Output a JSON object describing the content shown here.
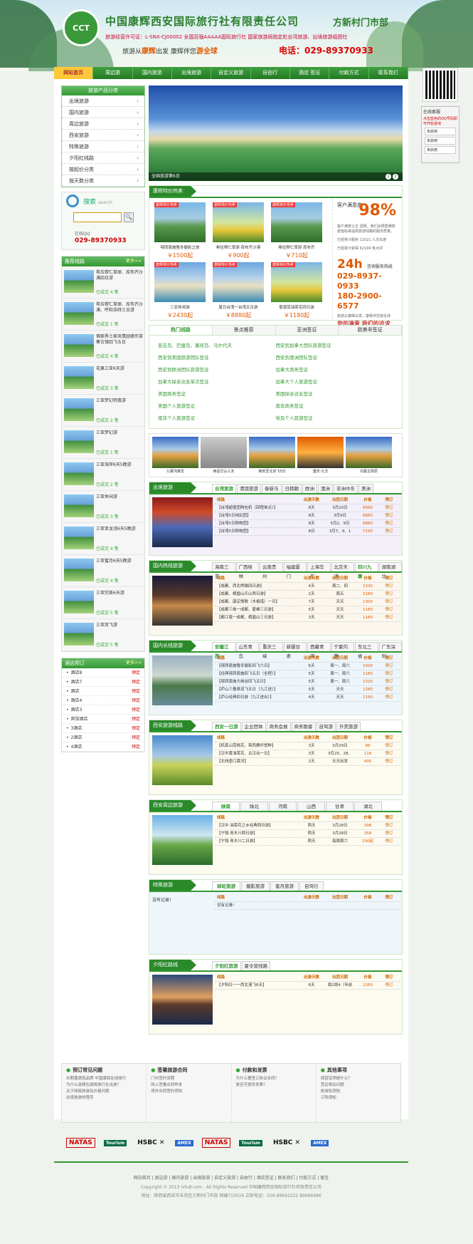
{
  "header": {
    "logo_text": "CCT",
    "company": "中国康辉西安国际旅行社有限责任公司",
    "branch": "方新村门市部",
    "license": "旅游经营许可证：L-SNX-CJ00002   全国百强AAAAA国际旅行社   国家旅游局指定赴台湾旅游、出境旅游组团社",
    "slogan_a": "旅游从",
    "slogan_b": "康辉",
    "slogan_c": "出发   康辉伴您",
    "slogan_d": "游全球",
    "phone": "电话：029-89370933"
  },
  "nav": [
    "网站首页",
    "周边游",
    "国内旅游",
    "出境旅游",
    "自定义旅游",
    "自由行",
    "酒店 签证",
    "付款方式",
    "联系我们"
  ],
  "kefu": {
    "title": "在线客服",
    "sub": "点击蓝色的QQ号码即可开始咨询",
    "btns": [
      "未启用",
      "未启用",
      "未启用"
    ]
  },
  "sidebar": {
    "cat_title": "旅游产品分类",
    "cats": [
      "出境旅游",
      "国内旅游",
      "周边旅游",
      "西安旅游",
      "特殊旅游",
      "夕阳红线路",
      "按起价分类",
      "按天数分类"
    ],
    "search_title": "搜索",
    "search_sub": "search",
    "search_btn": "🔍",
    "qq_label": "在线QQ",
    "tel": "029-89370933",
    "rec_title": "推荐线路",
    "more": "更多>>",
    "rec": [
      {
        "title": "希拉穆仁草原、库布齐沙漠四日游",
        "sold": "已成交 4 笔"
      },
      {
        "title": "希拉穆仁草原、库布齐沙漠、呼和浩特三日游",
        "sold": "已成交 1 笔"
      },
      {
        "title": "佛家界土家风情园德夯苗寨古镇四飞五日",
        "sold": "已成交 4 笔"
      },
      {
        "title": "花果三亚6天游",
        "sold": "已成交 3 笔"
      },
      {
        "title": "三亚梦幻特惠游",
        "sold": "已成交 2 笔"
      },
      {
        "title": "三亚梦幻游",
        "sold": "已成交 1 笔"
      },
      {
        "title": "三亚海岸6天5晚游",
        "sold": "已成交 2 笔"
      },
      {
        "title": "三亚休闲游",
        "sold": "已成交 3 笔"
      },
      {
        "title": "三亚亚龙湾6天5晚游",
        "sold": "已成交 4 笔"
      },
      {
        "title": "三亚蜜月6天5晚游",
        "sold": "已成交 4 笔"
      },
      {
        "title": "三亚完美6天游",
        "sold": "已成交 5 笔"
      },
      {
        "title": "三亚双飞游",
        "sold": "已成交 5 笔"
      }
    ],
    "hotel_title": "酒店预订",
    "hotels": [
      "酒店8",
      "酒店7",
      "酒店",
      "酒店4",
      "酒店3",
      "宾馆酒店",
      "3酒店",
      "2酒店",
      "4酒店"
    ],
    "book": "预定"
  },
  "banner": {
    "caption": "全国旅游第6日"
  },
  "special": {
    "title": "康辉特价热卖",
    "tag": "康辉特价热卖",
    "cards": [
      {
        "name": "鄂西恩施隆冬摄影之旅",
        "price": "￥1500起"
      },
      {
        "name": "希拉穆仁草原·库布齐沙漠",
        "price": "￥900起"
      },
      {
        "name": "希拉穆仁草原·库布齐",
        "price": "￥710起"
      },
      {
        "name": "三亚休闲游",
        "price": "￥2430起"
      },
      {
        "name": "夏日台湾一台湾五日游",
        "price": "￥8880起"
      },
      {
        "name": "婺源赏油菜花四日游",
        "price": "￥1180起"
      }
    ],
    "sat_label": "客户满意度",
    "sat_pct": "98%",
    "sat_text": "客户满意公正·透明，我们会根据满意度指标来提高旅游线路的服务质量。",
    "stat1": "已经累计服务 11021 人次出游",
    "stat2": "已经累计获得 62194 条点评",
    "h24": "24h",
    "h24_sub": "咨询服务热线",
    "tel1": "029-8937-0933",
    "tel2": "180-2900-6577",
    "foot": "旅游从康辉出发，康辉伴您游全球",
    "foot2": "您的满意  我们的追求"
  },
  "hotlinks": {
    "tabs": [
      "热门线路",
      "景点推荐",
      "亚洲签证",
      "欧美非签证"
    ],
    "items": [
      "普吉岛、巴厘岛、塞班岛、马尔代夫",
      "西安到加拿大团队旅游签证",
      "西安到美国旅游团队签证",
      "西安到澳洲团队签证",
      "西安到欧洲团队旅游签证",
      "加拿大商务签证",
      "加拿大探亲访友单次签证",
      "加拿大个人旅游签证",
      "美国商务签证",
      "美国探亲访友签证",
      "美国个人旅游签证",
      "南非商务签证",
      "南非个人旅游签证",
      "埃及个人旅游签证"
    ]
  },
  "strip": [
    "九寨沟黄龙",
    "西岳华山三天",
    "西安至北京飞5日",
    "重庆·九华",
    "内蒙古草原"
  ],
  "outbound": {
    "title": "出境旅游",
    "tabs": [
      "台湾旅游",
      "港澳旅游",
      "泰新马",
      "日韩朝",
      "欧洲",
      "澳洲",
      "非洲中东",
      "美洲"
    ],
    "head": [
      "线路",
      "出游天数",
      "出团日期",
      "价格",
      "预订"
    ],
    "rows": [
      [
        "【台湾超值团购包机（回程单点）】",
        "8天",
        "3月10日",
        "6990",
        "预订"
      ],
      [
        "【台湾5日纯玩团】",
        "8天",
        "3月9日",
        "6880",
        "预订"
      ],
      [
        "【台湾5日购物团】",
        "8天",
        "5月2、9日",
        "6880",
        "预订"
      ],
      [
        "【台湾5日购物团】",
        "8日",
        "3月7、9、1",
        "7190",
        "预订"
      ]
    ]
  },
  "domestic_hot": {
    "title": "国内热线旅游",
    "tabs": [
      "海南三亚",
      "广西桂林",
      "云南贵州",
      "福建厦门",
      "上海华东",
      "北京天津",
      "四川九寨",
      "湖南湖北"
    ],
    "head": [
      "线路",
      "出游天数",
      "出团日期",
      "价格",
      "预订"
    ],
    "rows": [
      [
        "【成都、西北熊猫四日游】",
        "4天",
        "周二、四",
        "1330",
        "预订"
      ],
      [
        "【成都、峨眉山乐山两日游】",
        "2天",
        "周五",
        "2180",
        "预订"
      ],
      [
        "【成都、康定情歌（木格措）一日】",
        "7天",
        "天天",
        "1300",
        "预订"
      ],
      [
        "【成都三峡一成都、夏峰三日游】",
        "5天",
        "天天",
        "1180",
        "预订"
      ],
      [
        "【都江堰一成都、峨眉山三日游】",
        "3天",
        "天天",
        "1180",
        "预订"
      ]
    ]
  },
  "domestic_long": {
    "title": "国内长线旅游",
    "tabs": [
      "安徽江西",
      "山东青岛",
      "重庆三峡",
      "新疆甘肃",
      "西藏青海",
      "宁夏内蒙",
      "东北三省",
      "广东深圳"
    ],
    "head": [
      "线路",
      "出游天数",
      "出团日期",
      "价格",
      "预订"
    ],
    "rows": [
      [
        "【鄂西恩施隆冬摄影四飞六日】",
        "6天",
        "周一、周六",
        "1500",
        "预订"
      ],
      [
        "【经典鄂西恩施四飞五日（全程）】",
        "5天",
        "周一、周六",
        "1180",
        "预订"
      ],
      [
        "【鄂西恩施大峡谷四飞五日】",
        "5天",
        "周一、周六",
        "1320",
        "预订"
      ],
      [
        "【庐山三叠泉双飞五日（九江进）】",
        "5天",
        "天天",
        "1280",
        "预订"
      ],
      [
        "【庐山经典四日游（九江进出）】",
        "4天",
        "天天",
        "1190",
        "预订"
      ]
    ]
  },
  "xian": {
    "title": "西安旅游线路",
    "tabs": [
      "西安一日游",
      "企业团体",
      "商务会展",
      "商务散客",
      "自驾游",
      "外宾旅游"
    ],
    "head": [
      "线路",
      "出游天数",
      "出团日期",
      "价格",
      "预订"
    ],
    "rows": [
      [
        "【机蒸山赏桃花，蒋西赛纤馆鲜】",
        "3天",
        "3月29日",
        "96",
        "预订"
      ],
      [
        "【汉中黄油菜花、古汉台一日】",
        "3天",
        "3月25、28、",
        "118",
        "预订"
      ],
      [
        "【北线壶口黄河】",
        "2天",
        "天天出发",
        "400",
        "预订"
      ]
    ]
  },
  "around": {
    "title": "西安周边旅游",
    "tabs": [
      "陕南",
      "陕北",
      "河南",
      "山西",
      "甘肃",
      "湖北"
    ],
    "head": [
      "线路",
      "出游天数",
      "出团日期",
      "价格",
      "预订"
    ],
    "rows": [
      [
        "【汉中·油菜花之乡经典两日游】",
        "两天",
        "3月28日",
        "398",
        "预订"
      ],
      [
        "【宁强·青木川两日游】",
        "两天",
        "3月28日",
        "358",
        "预订"
      ],
      [
        "【宁强·青木川二日游】",
        "两天",
        "每周周六",
        "290起",
        "预订"
      ]
    ]
  },
  "special_travel": {
    "title": "特殊旅游",
    "tabs": [
      "邮轮旅游",
      "摄影旅游",
      "蜜月旅游",
      "自驾行"
    ],
    "empty": "没有记录!",
    "head": [
      "线路",
      "出游天数",
      "出团日期",
      "价格",
      "预订"
    ],
    "empty2": "没有记录!"
  },
  "sunset": {
    "title": "夕阳红路线",
    "tabs": [
      "夕阳红旅游",
      "夏令营线路"
    ],
    "head": [
      "线路",
      "出游天数",
      "出团日期",
      "价格",
      "预订"
    ],
    "rows": [
      [
        "【夕阳红一一西北漫飞6天】",
        "6天",
        "周2周4（年前",
        "2260",
        "预订"
      ]
    ]
  },
  "footer_cols": [
    {
      "title": "预订常见问题",
      "items": [
        "长期遭遇低品牌 中国康辉在线旅行",
        "为什么选择在康辉旅行社出游？",
        "关于网络旅游及价格问题",
        "出境旅游的程序"
      ]
    },
    {
      "title": "签署旅游合同",
      "items": [
        "门市签约流程",
        "网上签署合同样本",
        "境外合同签约须知"
      ]
    },
    {
      "title": "付款和发票",
      "items": [
        "为什么要签订协议合同？",
        "是否可提供发票？"
      ]
    },
    {
      "title": "其他事项",
      "items": [
        "保密证明是什么？",
        "签证相关问题",
        "旅游险须知",
        "订购须知"
      ]
    }
  ],
  "pays": [
    "NATAS",
    "Tourism",
    "HSBC ✕",
    "AMEX",
    "NATAS",
    "Tourism",
    "HSBC ✕",
    "AMEX"
  ],
  "footer": {
    "nav": "网站首页 | 周边游 | 国内旅游 | 出境旅游 | 自定义旅游 | 自由行 | 酒店签证 | 联系我们 | 付款方式 | 留言",
    "copy": "Copyright © 2013 lvfu8.com . All Rights Reserved 中国康辉西安国际旅行社有限责任公司",
    "addr": "地址：陕西省西安市未央区方新村门市部    邮编710016    立即电话：029-89693222 89696686"
  }
}
